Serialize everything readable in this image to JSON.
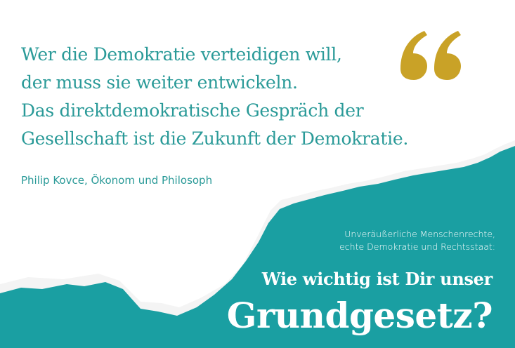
{
  "quote": {
    "lines": [
      "Wer die Demokratie verteidigen will,",
      "der muss sie weiter entwickeln.",
      "Das direktdemokratische Gespräch der",
      "Gesellschaft ist die Zukunft der Demokratie."
    ],
    "attribution": "Philip Kovce, Ökonom und Philosoph"
  },
  "banner": {
    "subtitle_lines": [
      "Unveräußerliche Menschenrechte,",
      "echte Demokratie und Rechtsstaat:"
    ],
    "headline_line1": "Wie wichtig ist Dir unser",
    "headline_line2": "Grundgesetz?"
  },
  "colors": {
    "accent_teal": "#2a9a98",
    "banner_teal": "#1a9fa2",
    "quote_mark_gold": "#c9a227"
  },
  "icons": {
    "quote_mark": "double-opening-quote-icon"
  }
}
